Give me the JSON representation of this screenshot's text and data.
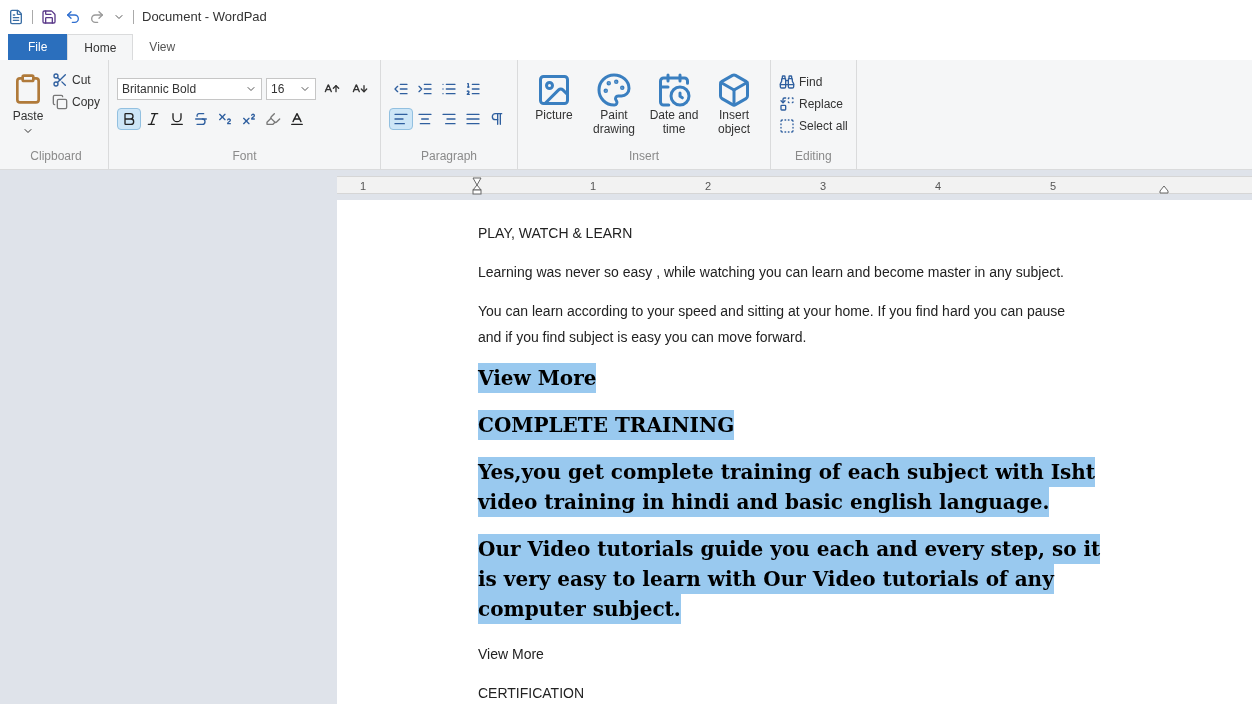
{
  "window": {
    "title": "Document - WordPad"
  },
  "tabs": [
    {
      "label": "File",
      "kind": "file",
      "selected": false
    },
    {
      "label": "Home",
      "kind": "tab",
      "selected": true
    },
    {
      "label": "View",
      "kind": "tab",
      "selected": false
    }
  ],
  "clipboard": {
    "label": "Clipboard",
    "paste": "Paste",
    "cut": "Cut",
    "copy": "Copy"
  },
  "font": {
    "label": "Font",
    "family": "Britannic Bold",
    "size": "16",
    "bold": true,
    "italic": false,
    "underline": false
  },
  "paragraph": {
    "label": "Paragraph",
    "align_left": true
  },
  "insert": {
    "label": "Insert",
    "items": [
      {
        "label": "Picture",
        "kind": "picture"
      },
      {
        "label": "Paint drawing",
        "kind": "paint"
      },
      {
        "label": "Date and time",
        "kind": "datetime"
      },
      {
        "label": "Insert object",
        "kind": "object"
      }
    ]
  },
  "editing": {
    "label": "Editing",
    "items": [
      {
        "label": "Find",
        "kind": "find"
      },
      {
        "label": "Replace",
        "kind": "replace"
      },
      {
        "label": "Select all",
        "kind": "selectall"
      }
    ]
  },
  "ruler": {
    "numbers": [
      "1",
      "1",
      "2",
      "3",
      "4",
      "5"
    ]
  },
  "document": {
    "paragraphs": [
      {
        "lines": [
          "PLAY, WATCH & LEARN"
        ],
        "kind": "body",
        "selected": false
      },
      {
        "lines": [
          "Learning was never so easy , while watching you can learn and become master in any subject."
        ],
        "kind": "body",
        "selected": false
      },
      {
        "lines": [
          "You can learn according to your speed and sitting at your home. If you find hard you can pause",
          "and if you find subject is easy you can move forward."
        ],
        "kind": "body",
        "selected": false
      },
      {
        "lines": [
          "View More"
        ],
        "kind": "heavy",
        "selected": true
      },
      {
        "lines": [
          "COMPLETE TRAINING"
        ],
        "kind": "heavy",
        "selected": true
      },
      {
        "lines": [
          "Yes,you get complete training of each subject with Isht",
          "video training in hindi and basic english language."
        ],
        "kind": "heavy",
        "selected": true
      },
      {
        "lines": [
          "Our Video tutorials guide you each and every step, so it",
          "is very easy to learn with Our Video tutorials of any",
          "computer subject."
        ],
        "kind": "heavy",
        "selected": true
      },
      {
        "lines": [
          "View More"
        ],
        "kind": "body",
        "selected": false
      },
      {
        "lines": [
          "CERTIFICATION"
        ],
        "kind": "body",
        "selected": false
      }
    ]
  }
}
